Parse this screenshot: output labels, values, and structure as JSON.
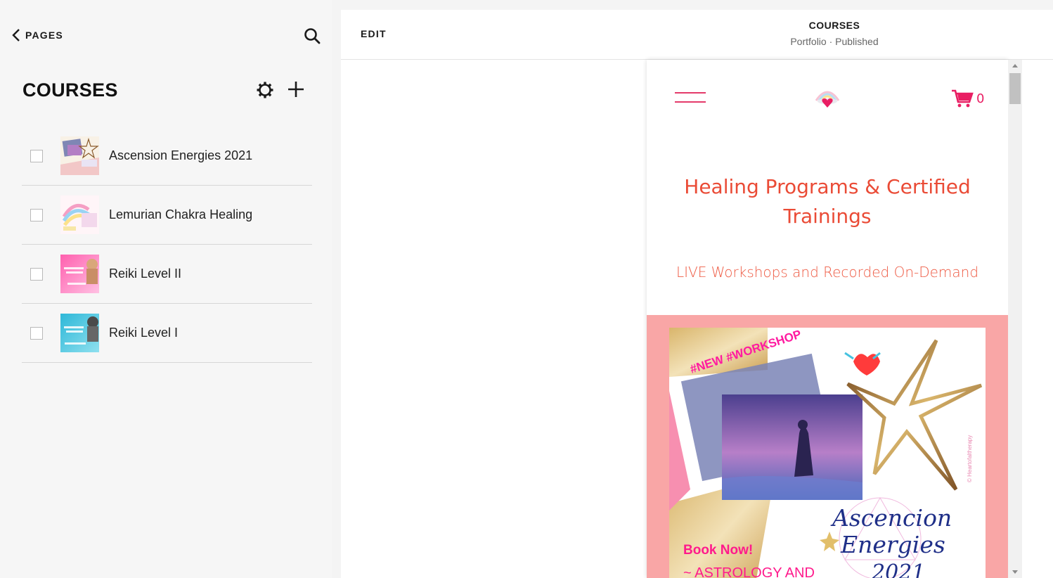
{
  "sidebar": {
    "back_label": "PAGES",
    "back_icon": "chevron-left-icon",
    "search_icon": "search-icon",
    "section_title": "COURSES",
    "settings_icon": "gear-icon",
    "add_icon": "plus-icon",
    "items": [
      {
        "title": "Ascension Energies 2021"
      },
      {
        "title": "Lemurian Chakra Healing"
      },
      {
        "title": "Reiki Level II"
      },
      {
        "title": "Reiki Level I"
      }
    ]
  },
  "topbar": {
    "edit_label": "EDIT",
    "page_name": "COURSES",
    "page_status": "Portfolio · Published"
  },
  "preview": {
    "cart_count": "0",
    "hero_title": "Healing Programs & Certified Trainings",
    "hero_subtitle": "LIVE Workshops and Recorded On-Demand",
    "promo_card": {
      "tag": "#NEW #WORKSHOP",
      "cta": "Book Now!",
      "line": "~ ASTROLOGY AND",
      "script_title_1": "Ascencion",
      "script_title_2": "Energies",
      "script_title_3": "2021",
      "credit": "© Heartofaltherapy"
    }
  },
  "colors": {
    "accent_pink": "#e91e63",
    "hero_red": "#ea4b36",
    "promo_band": "#f9a6a6",
    "sidebar_bg": "#f6f6f6"
  }
}
